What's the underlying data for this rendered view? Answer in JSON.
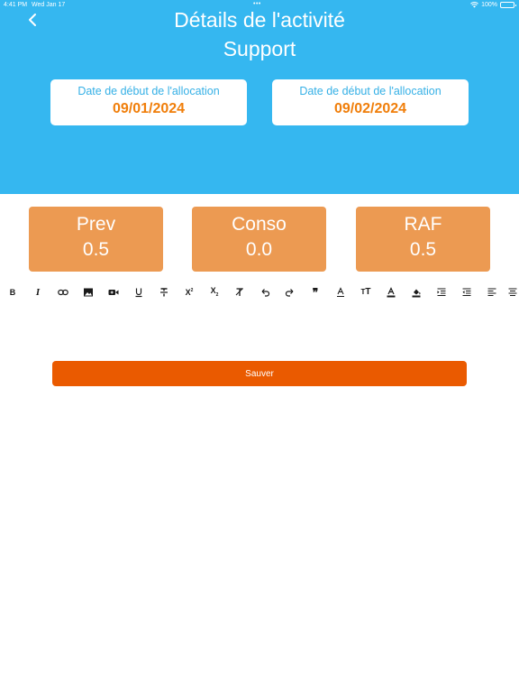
{
  "status_bar": {
    "time": "4:41 PM",
    "date": "Wed Jan 17",
    "battery": "100%"
  },
  "header": {
    "title": "Détails de l'activité",
    "subtitle": "Support",
    "background": "#35b7f0"
  },
  "dates": [
    {
      "label": "Date de début de l'allocation",
      "value": "09/01/2024"
    },
    {
      "label": "Date de début de l'allocation",
      "value": "09/02/2024"
    }
  ],
  "stats": [
    {
      "label": "Prev",
      "value": "0.5"
    },
    {
      "label": "Conso",
      "value": "0.0"
    },
    {
      "label": "RAF",
      "value": "0.5"
    }
  ],
  "toolbar": {
    "items": [
      "bold",
      "italic",
      "link",
      "image",
      "video",
      "underline",
      "strikethrough",
      "superscript",
      "subscript",
      "clear-format",
      "undo",
      "redo",
      "blockquote",
      "text-color",
      "font-size",
      "font-color",
      "highlight-color",
      "indent",
      "outdent",
      "align-left",
      "align-center"
    ]
  },
  "actions": {
    "save_label": "Sauver"
  },
  "colors": {
    "accent": "#ea5a00",
    "stat_card": "#ec9a52",
    "date_value": "#f07e0a"
  }
}
